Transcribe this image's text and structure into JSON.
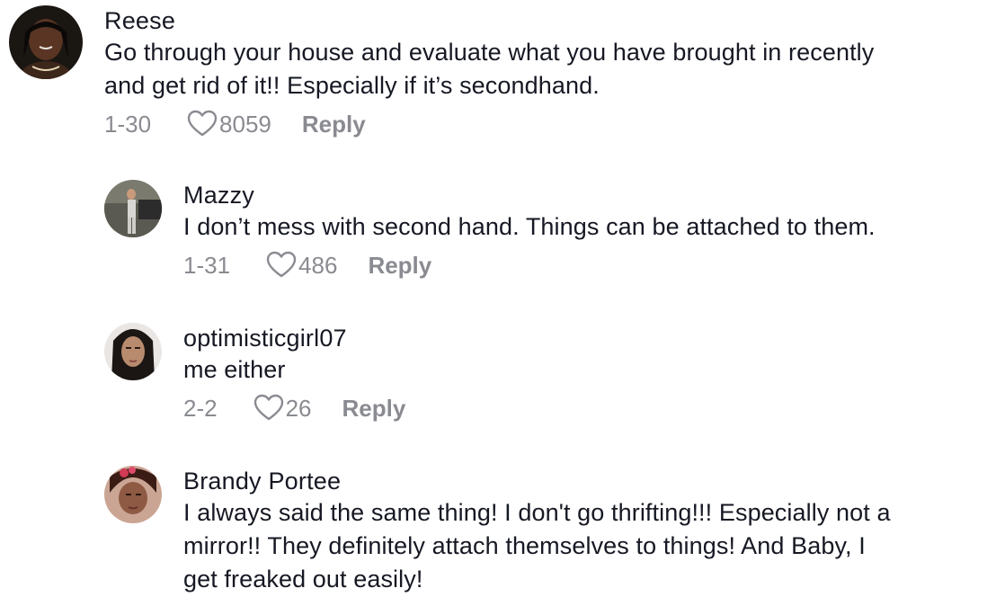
{
  "comments": [
    {
      "username": "Reese",
      "text_line1": "Go through your house and evaluate what you have brought in recently",
      "text_line2": "and get rid of it!! Especially if it’s secondhand.",
      "date": "1-30",
      "likes": "8059",
      "reply_label": "Reply"
    },
    {
      "username": "Mazzy",
      "text_line1": "I don’t mess with second hand. Things can be attached to them.",
      "date": "1-31",
      "likes": "486",
      "reply_label": "Reply"
    },
    {
      "username": "optimisticgirl07",
      "text_line1": "me either",
      "date": "2-2",
      "likes": "26",
      "reply_label": "Reply"
    },
    {
      "username": "Brandy Portee",
      "text_line1": "I always said the same thing! I don't go thrifting!!! Especially not a",
      "text_line2": "mirror!! They definitely attach themselves to things! And Baby, I",
      "text_line3": "get freaked out easily!"
    }
  ],
  "icons": {
    "like": "heart-outline-icon"
  },
  "colors": {
    "text": "#161823",
    "muted": "#8a8b91"
  }
}
